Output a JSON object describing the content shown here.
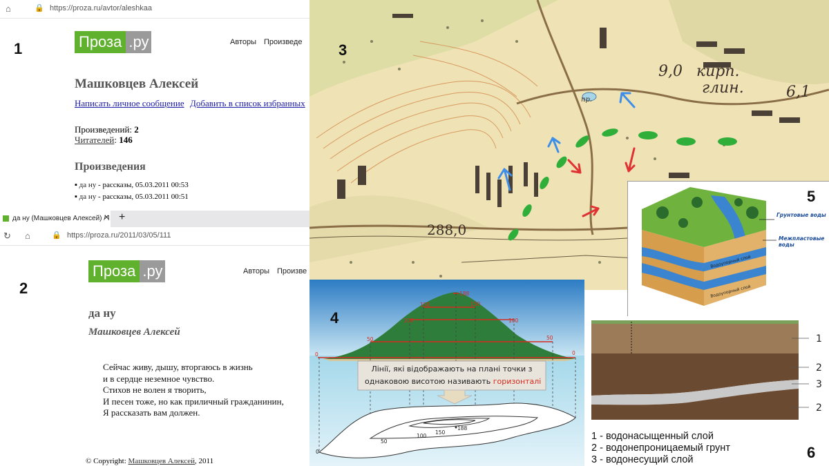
{
  "labels": {
    "p1": "1",
    "p2": "2",
    "p3": "3",
    "p4": "4",
    "p5": "5",
    "p6": "6"
  },
  "panel1": {
    "url": "https://proza.ru/avtor/aleshkaa",
    "logo_main": "Проза",
    "logo_suffix": ".ру",
    "nav_authors": "Авторы",
    "nav_works": "Произведе",
    "author_name": "Машковцев Алексей",
    "link_message": "Написать личное сообщение",
    "link_favorites": "Добавить в список избранных",
    "works_label": "Произведений: ",
    "works_count": "2",
    "readers_label": "Читателей",
    "readers_count": "146",
    "section_title": "Произведения",
    "items": [
      {
        "title": "да ну",
        "meta": " - рассказы, 05.03.2011 00:53"
      },
      {
        "title": "да ну",
        "meta": " - рассказы, 05.03.2011 00:51"
      }
    ]
  },
  "panel2": {
    "tab_title": "да ну (Машковцев Алексей) / П",
    "url": "https://proza.ru/2011/03/05/111",
    "logo_main": "Проза",
    "logo_suffix": ".ру",
    "nav_authors": "Авторы",
    "nav_works": "Произве",
    "title": "да ну",
    "author": "Машковцев Алексей",
    "poem": [
      "Сейчас живу, дышу, вторгаюсь в жизнь",
      "и в сердце неземное чувство.",
      "Стихов не волен я творить,",
      "И песен тоже, но как приличный гражданинин,",
      "Я рассказать вам должен."
    ],
    "copyright_prefix": "© Copyright: ",
    "copyright_author": "Машковцев Алексей",
    "copyright_year": ", 2011"
  },
  "panel3": {
    "map_labels": [
      "9,0",
      "кирп.",
      "глин.",
      "6,1",
      "288,0",
      "пр."
    ]
  },
  "panel4": {
    "heights": [
      "188",
      "150",
      "150",
      "100",
      "100",
      "50",
      "50",
      "0",
      "0"
    ],
    "contour_labels": [
      "188",
      "150",
      "100",
      "50",
      "0"
    ],
    "caption_line1": "Лінії, які відображають на плані точки з",
    "caption_line2": "однаковою висотою називають ",
    "caption_term": "горизонталі"
  },
  "panel5": {
    "label_ground": "Грунтовые воды",
    "label_interlayer": "Межпластовые воды",
    "label_layer1": "Водоупорный слой",
    "label_layer2": "Водоупорный слой"
  },
  "panel6": {
    "markers": [
      "1",
      "2",
      "3",
      "2"
    ],
    "legend": [
      "1 - водонасыщенный слой",
      "2 - водонепроницаемый грунт",
      "3 - водонесущий слой"
    ]
  }
}
